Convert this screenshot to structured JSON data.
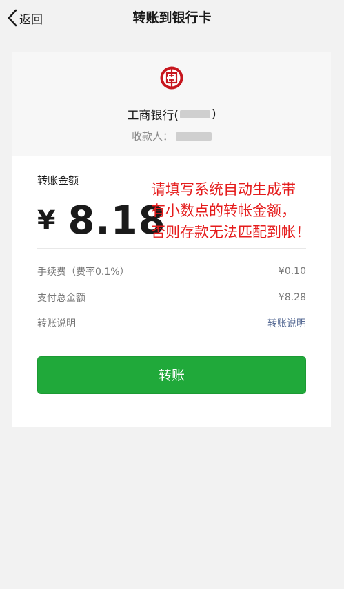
{
  "header": {
    "back_label": "返回",
    "title": "转账到银行卡"
  },
  "bank": {
    "logo_icon": "icbc-logo-icon",
    "name": "工商银行(",
    "name_suffix": ")",
    "payee_label": "收款人："
  },
  "amount": {
    "label": "转账金额",
    "currency": "¥",
    "value": "8.18"
  },
  "annotation": {
    "lines": [
      "请填写系统自动生成带",
      "有小数点的转帐金额，",
      "否则存款无法匹配到帐！"
    ],
    "color": "#e51c1c"
  },
  "details": {
    "fee_label": "手续费（费率0.1%）",
    "fee_value": "¥0.10",
    "total_label": "支付总金额",
    "total_value": "¥8.28",
    "note_label": "转账说明",
    "note_link": "转账说明"
  },
  "actions": {
    "transfer_label": "转账",
    "button_color": "#20a93a"
  }
}
